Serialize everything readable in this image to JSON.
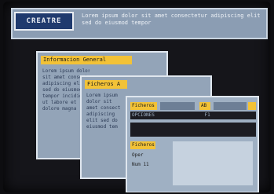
{
  "header": {
    "logo": "CREATRE",
    "message": "Lorem ipsum dolor sit amet consectetur adipiscing elit sed do eiusmod tempor"
  },
  "windows": [
    {
      "title": "Informacion General",
      "body": "Lorem ipsum dolor\nsit amet consect\nadipiscing elit\nsed do eiusmod\ntempor incidid\nut labore et\ndolore magna"
    },
    {
      "title": "Ficheros A",
      "body": "Lorem ipsum\ndolor sit\namet consect\nadipiscing\nelit sed do\neiusmod tem"
    },
    {
      "title": "Ficheros",
      "fields": [
        "Ficheros",
        "AB",
        "OPCIONES",
        "F1"
      ],
      "side": [
        "Ficheros",
        "Oper",
        "Num 11"
      ]
    }
  ]
}
